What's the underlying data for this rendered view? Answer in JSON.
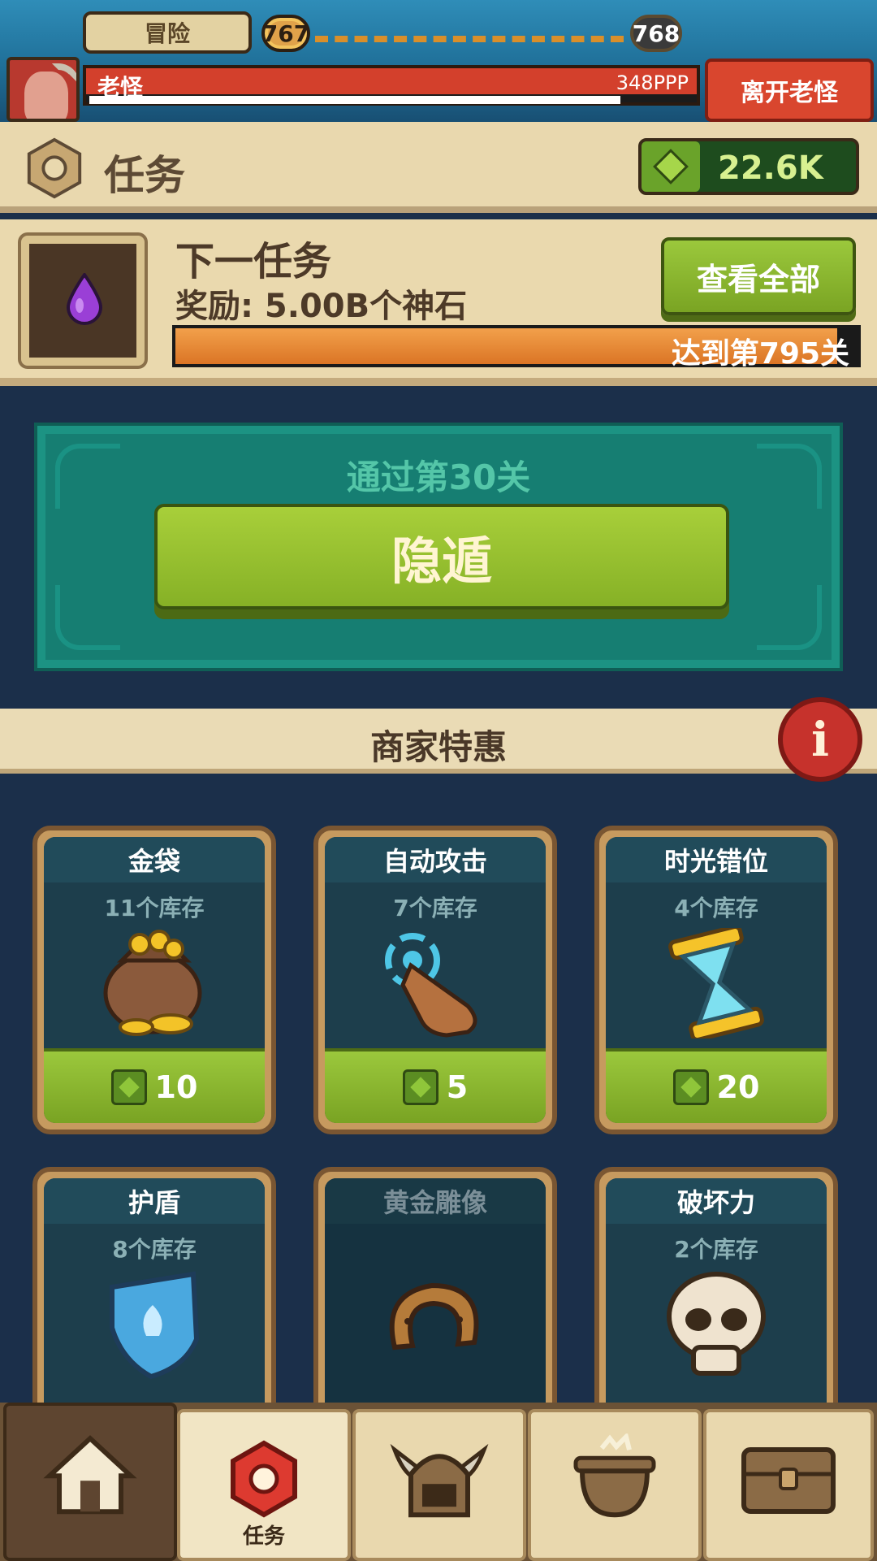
{
  "topbar": {
    "adventure_label": "冒险",
    "current_stage": "767",
    "next_stage": "768",
    "boss_name": "老怪",
    "boss_hp": "348PPP",
    "boss_hp_fraction": 1.0,
    "boss_timer_fraction": 0.87,
    "leave_boss_label": "离开老怪"
  },
  "mission_header": {
    "title": "任务",
    "gems": "22.6K"
  },
  "next_mission": {
    "title": "下一任务",
    "reward": "奖励: 5.00B个神石",
    "view_all_label": "查看全部",
    "progress_text": "达到第795关",
    "progress_fraction": 0.97
  },
  "retire": {
    "requirement": "通过第30关",
    "button_label": "隐遁"
  },
  "merchant": {
    "title": "商家特惠",
    "info_label": "i",
    "items": [
      {
        "name": "金袋",
        "stock": "11个库存",
        "price": "10",
        "icon": "gold-bag-icon"
      },
      {
        "name": "自动攻击",
        "stock": "7个库存",
        "price": "5",
        "icon": "tap-hand-icon"
      },
      {
        "name": "时光错位",
        "stock": "4个库存",
        "price": "20",
        "icon": "hourglass-icon"
      },
      {
        "name": "护盾",
        "stock": "8个库存",
        "price": "",
        "icon": "shield-icon"
      },
      {
        "name": "黄金雕像",
        "stock": "",
        "price": "",
        "icon": "horseshoe-icon"
      },
      {
        "name": "破坏力",
        "stock": "2个库存",
        "price": "",
        "icon": "skull-icon"
      }
    ]
  },
  "bottom_nav": {
    "tabs": [
      {
        "label": "",
        "icon": "home-icon"
      },
      {
        "label": "任务",
        "icon": "mission-nut-icon"
      },
      {
        "label": "",
        "icon": "viking-helmet-icon"
      },
      {
        "label": "",
        "icon": "cauldron-icon"
      },
      {
        "label": "",
        "icon": "treasure-chest-icon"
      }
    ]
  },
  "colors": {
    "accent_green": "#8fbf2f",
    "boss_red": "#d3402c",
    "progress_orange": "#e88a35",
    "panel_teal": "#167e72",
    "parchment": "#e9d8ae"
  }
}
